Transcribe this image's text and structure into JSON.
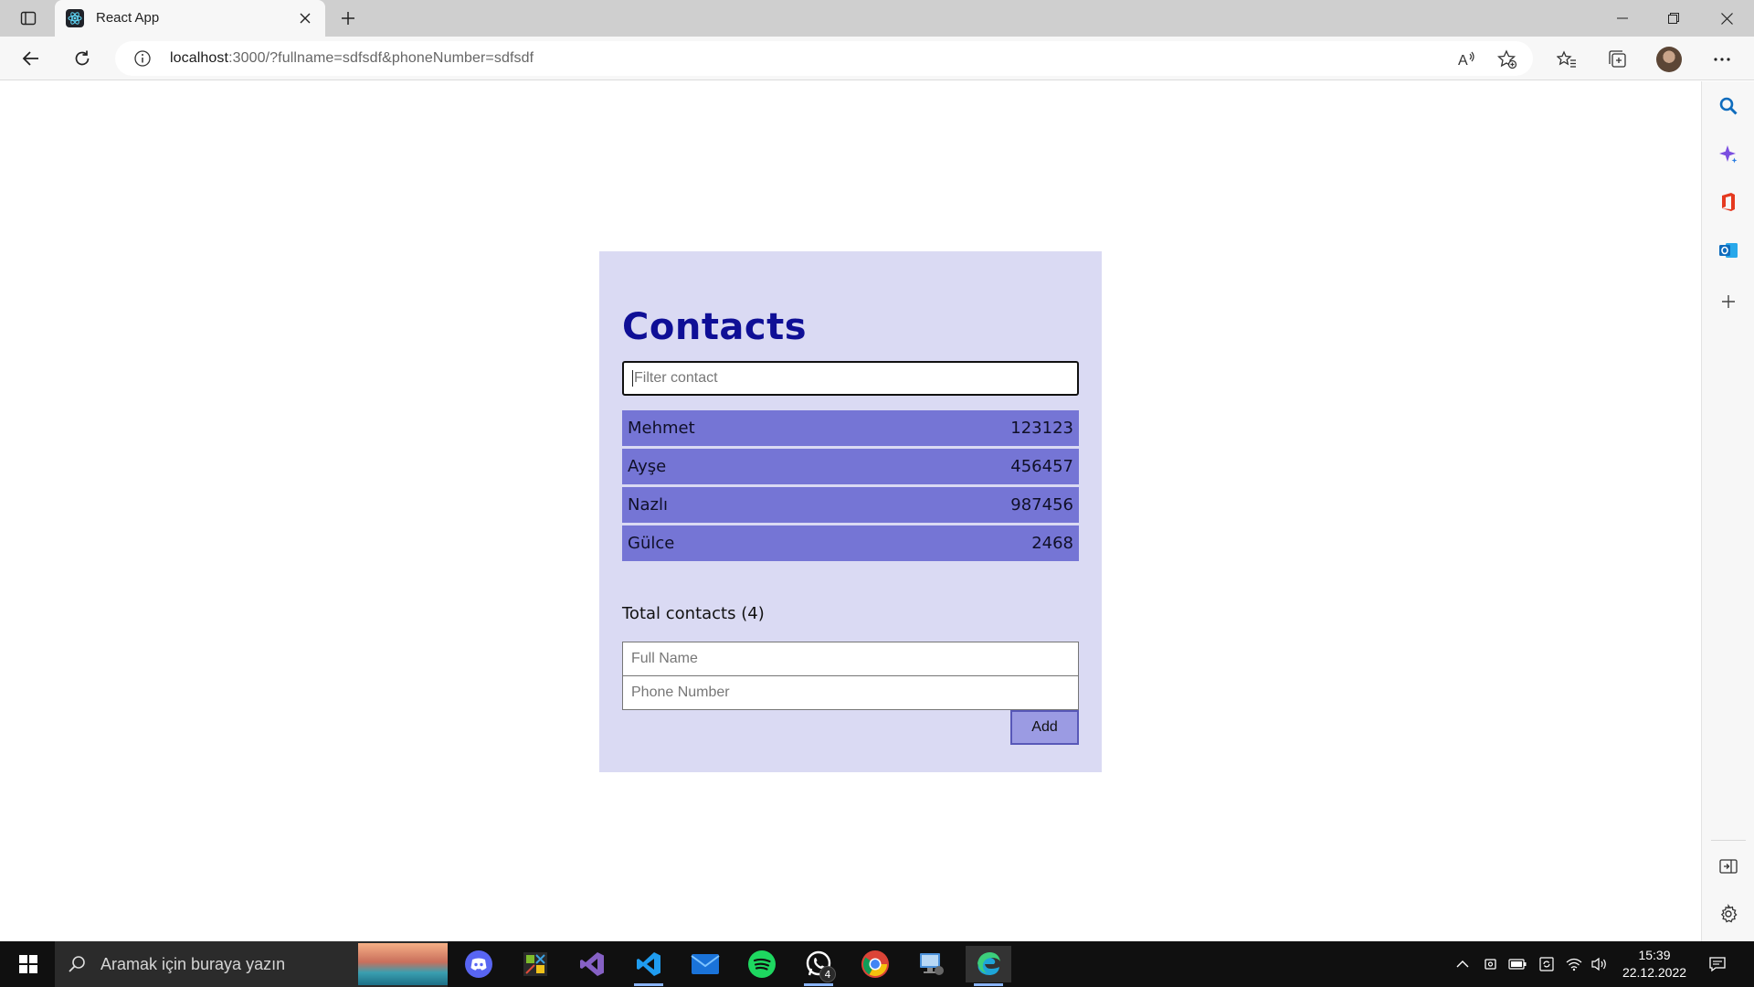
{
  "browser": {
    "tab_title": "React App",
    "url_host": "localhost",
    "url_rest": ":3000/?fullname=sdfsdf&phoneNumber=sdfsdf",
    "accent_color": "#0f6cbd"
  },
  "page": {
    "title": "Contacts",
    "filter_placeholder": "Filter contact",
    "contacts": [
      {
        "name": "Mehmet",
        "phone": "123123"
      },
      {
        "name": "Ayşe",
        "phone": "456457"
      },
      {
        "name": "Nazlı",
        "phone": "987456"
      },
      {
        "name": "Gülce",
        "phone": "2468"
      }
    ],
    "total_label": "Total contacts (4)",
    "fullname_placeholder": "Full Name",
    "phone_placeholder": "Phone Number",
    "add_label": "Add",
    "colors": {
      "card_bg": "#dadaf3",
      "title": "#0f0f96",
      "row_bg": "#7575d5",
      "button_bg": "#9b9be3"
    }
  },
  "sidebar_icons": [
    "search-icon",
    "copilot-icon",
    "office-icon",
    "outlook-icon",
    "add-icon",
    "hide-sidebar-icon",
    "settings-icon"
  ],
  "taskbar": {
    "search_placeholder": "Aramak için buraya yazın",
    "apps": [
      "discord",
      "green-app",
      "visual-studio",
      "vscode",
      "mail",
      "spotify",
      "whatsapp",
      "chrome",
      "remote-desktop",
      "edge"
    ],
    "whatsapp_badge": "4",
    "time": "15:39",
    "date": "22.12.2022"
  }
}
